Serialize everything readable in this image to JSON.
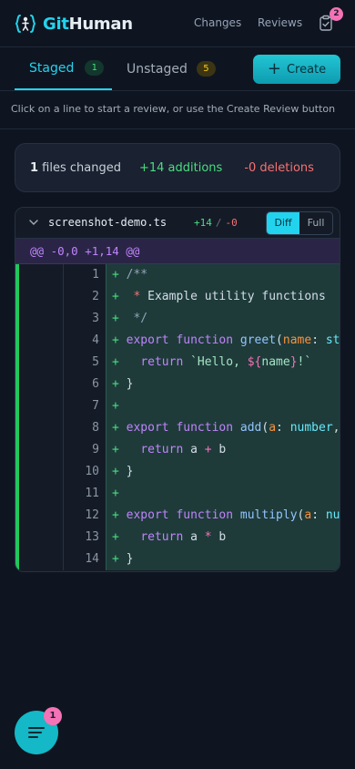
{
  "header": {
    "logo_git": "Git",
    "logo_human": "Human",
    "nav_changes": "Changes",
    "nav_reviews": "Reviews",
    "clipboard_badge": "2",
    "accent_color": "#22d3ee"
  },
  "tabs": {
    "staged_label": "Staged",
    "staged_count": "1",
    "unstaged_label": "Unstaged",
    "unstaged_count": "5",
    "create_label": "Create"
  },
  "hint": "Click on a line to start a review, or use the Create Review button",
  "summary": {
    "files_count": "1",
    "files_label": " files changed",
    "additions": "+14 additions",
    "deletions": "-0 deletions"
  },
  "file": {
    "name": "screenshot-demo.ts",
    "additions": "+14",
    "separator": "/",
    "deletions": "-0",
    "view_diff": "Diff",
    "view_full": "Full",
    "hunk_header": "@@ -0,0 +1,14 @@",
    "lines": [
      {
        "num": "1",
        "text": "/**"
      },
      {
        "num": "2",
        "text": " * Example utility functions"
      },
      {
        "num": "3",
        "text": " */"
      },
      {
        "num": "4",
        "text": "export function greet(name: string)"
      },
      {
        "num": "5",
        "text": "  return `Hello, ${name}!`"
      },
      {
        "num": "6",
        "text": "}"
      },
      {
        "num": "7",
        "text": ""
      },
      {
        "num": "8",
        "text": "export function add(a: number, b: number)"
      },
      {
        "num": "9",
        "text": "  return a + b"
      },
      {
        "num": "10",
        "text": "}"
      },
      {
        "num": "11",
        "text": ""
      },
      {
        "num": "12",
        "text": "export function multiply(a: number, b: number)"
      },
      {
        "num": "13",
        "text": "  return a * b"
      },
      {
        "num": "14",
        "text": "}"
      }
    ]
  },
  "fab": {
    "icon": "menu-icon",
    "badge": "1"
  }
}
